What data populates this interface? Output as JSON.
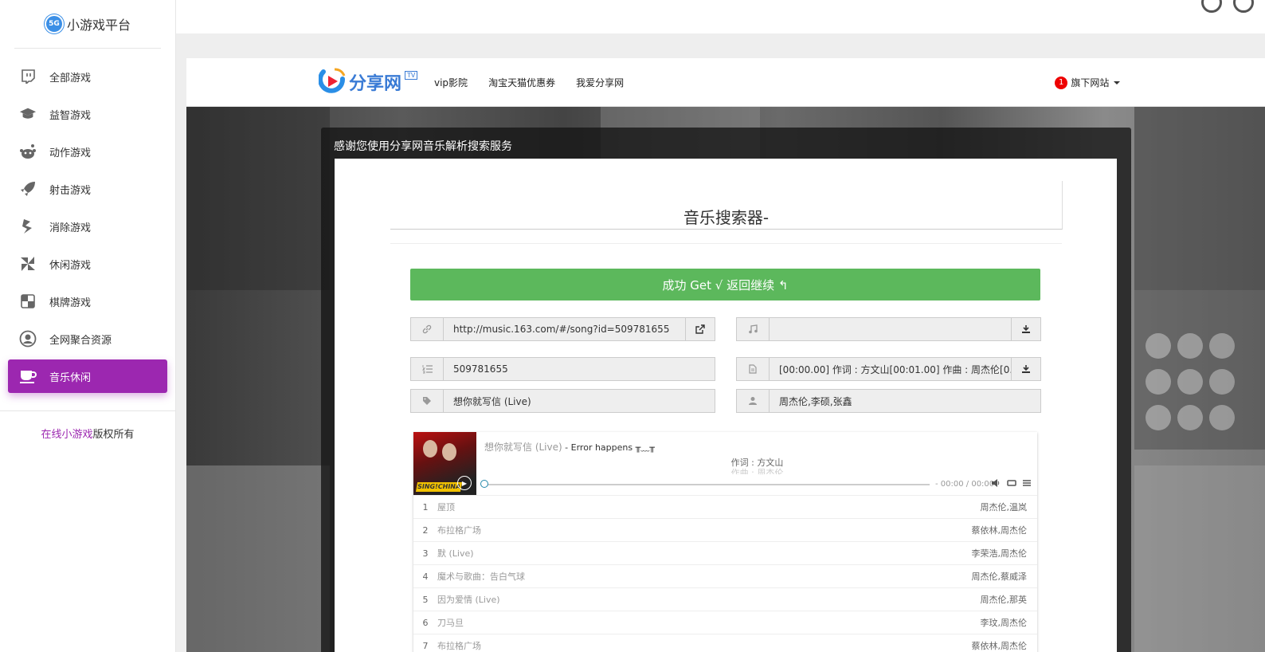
{
  "sidebar": {
    "logo_badge": "5G",
    "logo_text": "小游戏平台",
    "items": [
      {
        "label": "全部游戏",
        "icon": "twitch-icon"
      },
      {
        "label": "益智游戏",
        "icon": "graduation-cap-icon"
      },
      {
        "label": "动作游戏",
        "icon": "reddit-icon"
      },
      {
        "label": "射击游戏",
        "icon": "rocket-icon"
      },
      {
        "label": "消除游戏",
        "icon": "puzzle-icon"
      },
      {
        "label": "休闲游戏",
        "icon": "pinwheel-icon"
      },
      {
        "label": "棋牌游戏",
        "icon": "checkerboard-icon"
      },
      {
        "label": "全网聚合资源",
        "icon": "user-circle-icon"
      },
      {
        "label": "音乐休闲",
        "icon": "coffee-cup-icon",
        "active": true
      }
    ],
    "footer_link": "在线小游戏",
    "footer_text": "版权所有"
  },
  "topnav": {
    "brand": "分享网",
    "brand_tag": "TV",
    "menu": [
      "vip影院",
      "淘宝天猫优惠券",
      "我爱分享网"
    ],
    "badge": "1",
    "site_dropdown": "旗下网站"
  },
  "overlay_title": "感谢您使用分享网音乐解析搜索服务",
  "search_title": "音乐搜索器-",
  "success_button": "成功 Get √ 返回继续 ↰",
  "fields": {
    "url": "http://music.163.com/#/song?id=509781655",
    "music_url": "",
    "song_id": "509781655",
    "lyrics": "[00:00.00] 作词 : 方文山[00:01.00] 作曲 : 周杰伦[0...",
    "song_name": "想你就写信 (Live)",
    "artist": "周杰伦,李硕,张鑫"
  },
  "player": {
    "title": "想你就写信 (Live)",
    "error": " - Error happens ╥﹏╥",
    "lyric_current": "作词 : 方文山",
    "lyric_next": "作曲 : 周杰伦",
    "time": "- 00:00 / 00:00",
    "cover_text": "SING!CHINA",
    "playlist": [
      {
        "num": "1",
        "name": "屋顶",
        "artist": "周杰伦,温岚"
      },
      {
        "num": "2",
        "name": "布拉格广场",
        "artist": "蔡依林,周杰伦"
      },
      {
        "num": "3",
        "name": "默 (Live)",
        "artist": "李荣浩,周杰伦"
      },
      {
        "num": "4",
        "name": "魔术与歌曲：告白气球",
        "artist": "周杰伦,蔡威泽"
      },
      {
        "num": "5",
        "name": "因为爱情 (Live)",
        "artist": "周杰伦,那英"
      },
      {
        "num": "6",
        "name": "刀马旦",
        "artist": "李玟,周杰伦"
      },
      {
        "num": "7",
        "name": "布拉格广场",
        "artist": "蔡依林,周杰伦"
      }
    ]
  },
  "colors": {
    "accent": "#9c27b0",
    "success": "#5cb85c",
    "brand": "#3a7bd5"
  }
}
